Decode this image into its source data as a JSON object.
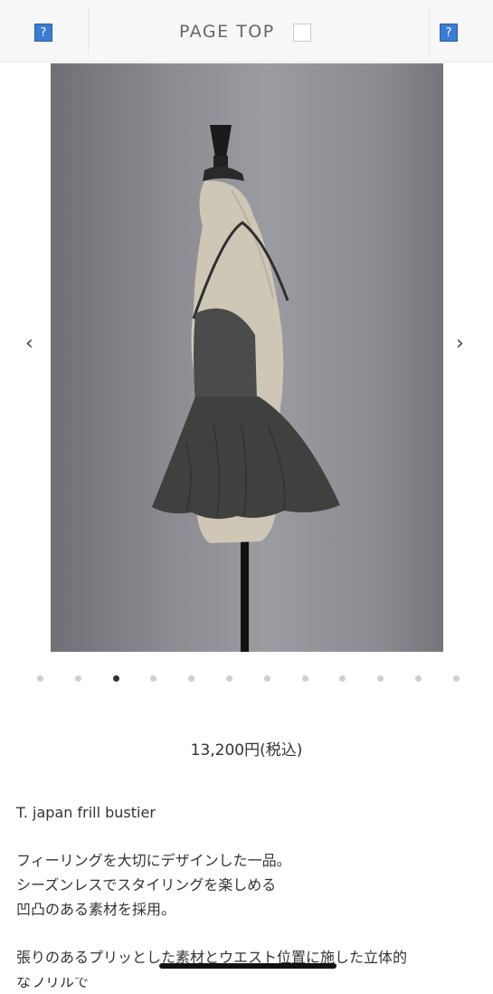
{
  "header": {
    "left_icon": "?",
    "page_top_label": "PAGE TOP",
    "right_icon": "?"
  },
  "carousel": {
    "prev_label": "‹",
    "next_label": "›",
    "dot_count": 12,
    "active_index": 2
  },
  "product": {
    "price": "13,200円(税込)",
    "name": "T. japan frill bustier",
    "desc_lines": [
      "フィーリングを大切にデザインした一品。",
      "シーズンレスでスタイリングを楽しめる",
      "凹凸のある素材を採用。"
    ],
    "desc2_line1": "張りのあるプリッとした素材とウエスト位置に施した立体的",
    "desc2_line2": "なフリルで"
  },
  "colors": {
    "accent_icon": "#3a7bd5",
    "dot_active": "#333333",
    "dot_inactive": "#cfcfcf"
  }
}
